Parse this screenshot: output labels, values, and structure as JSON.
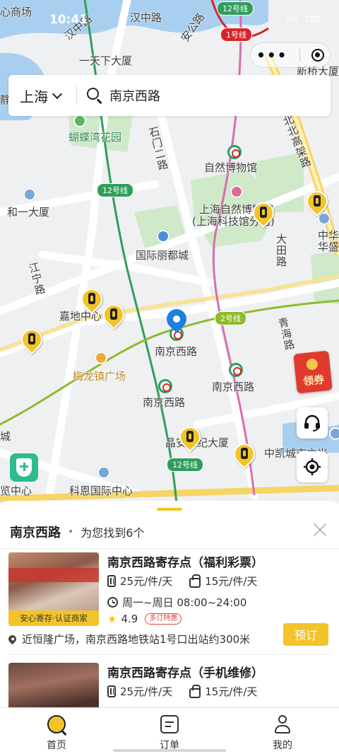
{
  "status_bar": {
    "time": "10:41",
    "battery_text": "100",
    "network": "5G"
  },
  "capsule": {
    "more_label": "•••"
  },
  "search": {
    "city": "上海",
    "query": "南京西路"
  },
  "map": {
    "labels": {
      "jiaotong_mall": "心商场",
      "hanzhong_rd": "汉中路",
      "hanzhong_rd_2": "汉中路",
      "yitianxia": "一天下大厦",
      "xinqiao": "新桥大厦",
      "jing": "静",
      "anlu": "安公路",
      "hudie_garden": "蝴蝶湾花园",
      "shimen_rd": "石门二路",
      "natural_museum": "自然博物馆",
      "north_elevated": "北北高架路",
      "heyi": "和一大厦",
      "sh_natural_museum": "上海自然博物馆",
      "sh_science_museum": "(上海科技馆分馆)",
      "datian_rd": "大田路",
      "zhonghua": "中华",
      "huasheng": "华盛",
      "intl_lidu": "国际丽都城",
      "jiangning_rd": "江宁路",
      "jiadi": "嘉地中心",
      "nanjingxi_1": "南京西路",
      "qinghai_rd": "青海路",
      "meilong": "梅龙镇广场",
      "nanjingxi_2": "南京西路",
      "nanjingxi_3": "南京西路",
      "jingan_century": "晶安世纪大厦",
      "zhongkai": "中凯城市之光",
      "cheng": "城",
      "lan": "览中心",
      "keen": "科恩国际中心"
    },
    "line_tags": {
      "line12_a": "12号线",
      "line1": "1号线",
      "line12_b": "12号线",
      "line2": "2号线",
      "line12_c": "12号线"
    }
  },
  "coupon": {
    "label": "领券"
  },
  "panel": {
    "title": "南京西路",
    "dot": "•",
    "result_count": "为您找到6个",
    "stores": [
      {
        "name": "南京西路寄存点（福利彩票）",
        "badge": "安心寄存·认证商家",
        "luggage_price": "25元/件/天",
        "bag_price": "15元/件/天",
        "hours": "周一~周日 08:00~24:00",
        "rating": "4.9",
        "promo": "多订特惠",
        "address": "近恒隆广场，南京西路地铁站1号口出站约300米",
        "book_label": "预订"
      },
      {
        "name": "南京西路寄存点（手机维修）",
        "luggage_price": "25元/件/天",
        "bag_price": "15元/件/天"
      }
    ]
  },
  "tabs": [
    {
      "label": "首页"
    },
    {
      "label": "订单"
    },
    {
      "label": "我的"
    }
  ],
  "colors": {
    "accent": "#f2c42a",
    "line2": "#8dbb2a",
    "line12": "#2f9e5c",
    "line1": "#d8232a",
    "metro_pin": "#1f7fe0"
  }
}
